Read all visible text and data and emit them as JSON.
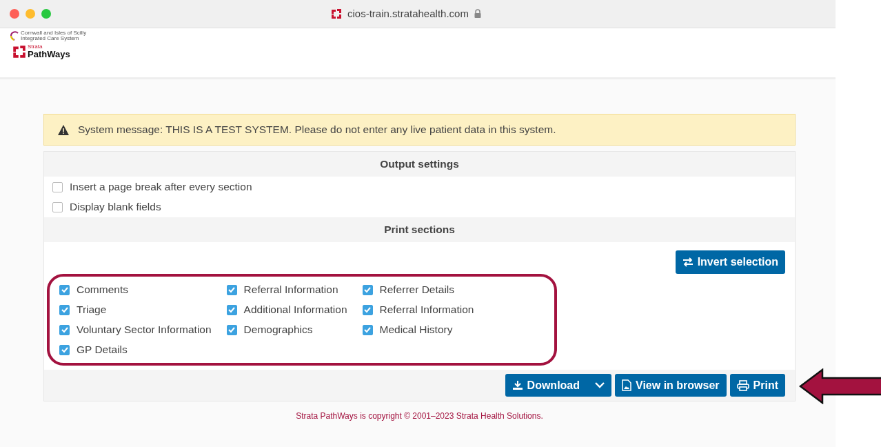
{
  "browser": {
    "url": "cios-train.stratahealth.com"
  },
  "header": {
    "org_logo_lines": [
      "Cornwall and Isles of Scilly",
      "Integrated Care System"
    ],
    "brand_small": "Strata",
    "brand": "PathWays"
  },
  "system_message": "System message: THIS IS A TEST SYSTEM. Please do not enter any live patient data in this system.",
  "output_settings": {
    "title": "Output settings",
    "options": [
      {
        "label": "Insert a page break after every section",
        "checked": false
      },
      {
        "label": "Display blank fields",
        "checked": false
      }
    ]
  },
  "print_sections": {
    "title": "Print sections",
    "invert_button": "Invert selection",
    "columns": [
      [
        {
          "label": "Comments",
          "checked": true
        },
        {
          "label": "Triage",
          "checked": true
        },
        {
          "label": "Voluntary Sector Information",
          "checked": true
        },
        {
          "label": "GP Details",
          "checked": true
        }
      ],
      [
        {
          "label": "Referral Information",
          "checked": true
        },
        {
          "label": "Additional Information",
          "checked": true
        },
        {
          "label": "Demographics",
          "checked": true
        }
      ],
      [
        {
          "label": "Referrer Details",
          "checked": true
        },
        {
          "label": "Referral Information",
          "checked": true
        },
        {
          "label": "Medical History",
          "checked": true
        }
      ]
    ]
  },
  "actions": {
    "download": "Download",
    "view": "View in browser",
    "print": "Print"
  },
  "footer": "Strata PathWays is copyright © 2001–2023 Strata Health Solutions."
}
